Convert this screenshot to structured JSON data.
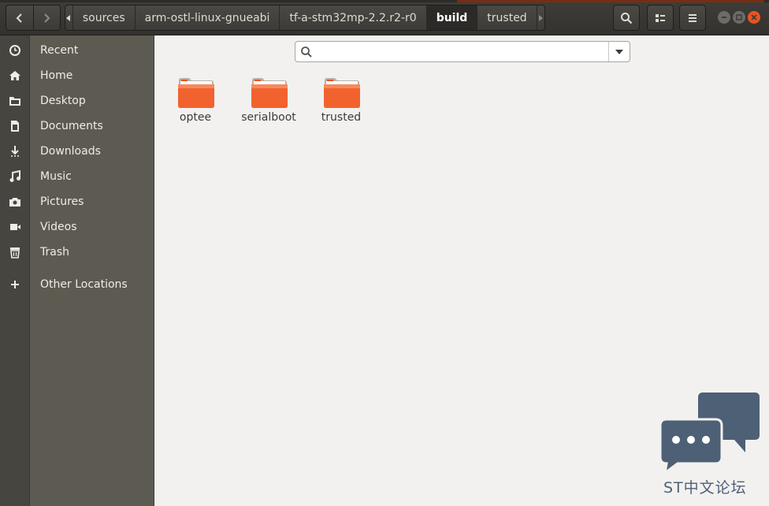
{
  "header": {
    "breadcrumbs": [
      "sources",
      "arm-ostl-linux-gnueabi",
      "tf-a-stm32mp-2.2.r2-r0",
      "build",
      "trusted"
    ],
    "active_crumb": "build"
  },
  "sidebar": {
    "items": [
      {
        "label": "Recent",
        "icon": "clock-icon"
      },
      {
        "label": "Home",
        "icon": "home-icon"
      },
      {
        "label": "Desktop",
        "icon": "folder-icon"
      },
      {
        "label": "Documents",
        "icon": "document-icon"
      },
      {
        "label": "Downloads",
        "icon": "download-icon"
      },
      {
        "label": "Music",
        "icon": "music-icon"
      },
      {
        "label": "Pictures",
        "icon": "camera-icon"
      },
      {
        "label": "Videos",
        "icon": "video-icon"
      },
      {
        "label": "Trash",
        "icon": "trash-icon"
      },
      {
        "label": "Other Locations",
        "icon": "plus-icon"
      }
    ]
  },
  "search": {
    "placeholder": ""
  },
  "files": [
    {
      "name": "optee"
    },
    {
      "name": "serialboot"
    },
    {
      "name": "trusted"
    }
  ],
  "watermark": {
    "text": "ST中文论坛"
  },
  "colors": {
    "accent": "#e95420",
    "sidebar": "#5d5b51",
    "header": "#3c3b37",
    "folder": "#f2622e"
  }
}
